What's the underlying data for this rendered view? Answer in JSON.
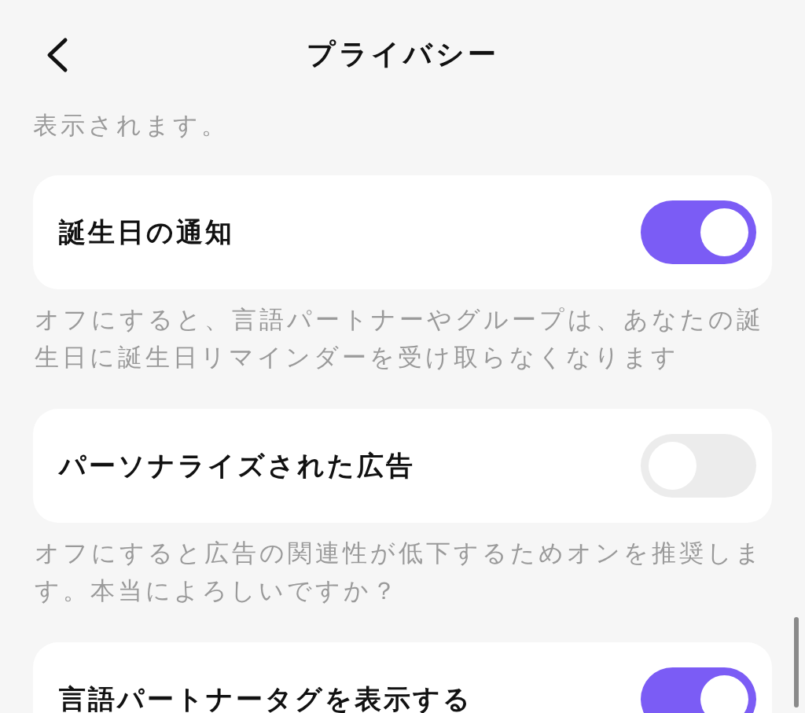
{
  "header": {
    "title": "プライバシー"
  },
  "intro_text": "表示されます。",
  "settings": [
    {
      "label": "誕生日の通知",
      "on": true,
      "description": "オフにすると、言語パートナーやグループは、あなたの誕生日に誕生日リマインダーを受け取らなくなります"
    },
    {
      "label": "パーソナライズされた広告",
      "on": false,
      "description": "オフにすると広告の関連性が低下するためオンを推奨します。本当によろしいですか？"
    },
    {
      "label": "言語パートナータグを表示する",
      "on": true
    }
  ]
}
